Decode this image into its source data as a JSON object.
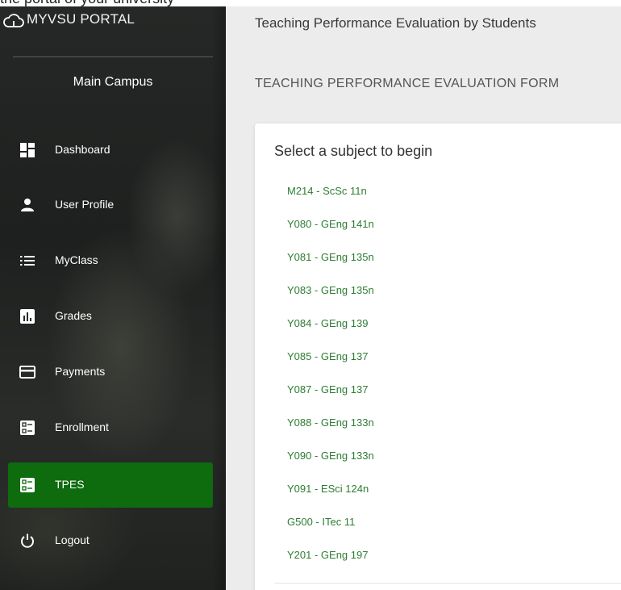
{
  "top_caption": "the portal of your university",
  "sidebar": {
    "brand": "MYVSU PORTAL",
    "campus": "Main Campus",
    "items": [
      {
        "label": "Dashboard",
        "icon": "dashboard-icon"
      },
      {
        "label": "User Profile",
        "icon": "person-icon"
      },
      {
        "label": "MyClass",
        "icon": "list-icon"
      },
      {
        "label": "Grades",
        "icon": "bar-chart-icon"
      },
      {
        "label": "Payments",
        "icon": "credit-card-icon"
      },
      {
        "label": "Enrollment",
        "icon": "form-icon"
      },
      {
        "label": "TPES",
        "icon": "form-icon",
        "active": true
      },
      {
        "label": "Logout",
        "icon": "power-icon"
      }
    ],
    "active_color": "#0e6b0e"
  },
  "main": {
    "page_title": "Teaching Performance Evaluation by Students",
    "form_title": "TEACHING PERFORMANCE EVALUATION FORM",
    "card": {
      "heading": "Select a subject to begin",
      "subjects": [
        "M214 - ScSc 11n",
        "Y080 - GEng 141n",
        "Y081 - GEng 135n",
        "Y083 - GEng 135n",
        "Y084 - GEng 139",
        "Y085 - GEng 137",
        "Y087 - GEng 137",
        "Y088 - GEng 133n",
        "Y090 - GEng 133n",
        "Y091 - ESci 124n",
        "G500 - ITec 11",
        "Y201 - GEng 197"
      ],
      "link_color": "#2e7d32"
    }
  }
}
